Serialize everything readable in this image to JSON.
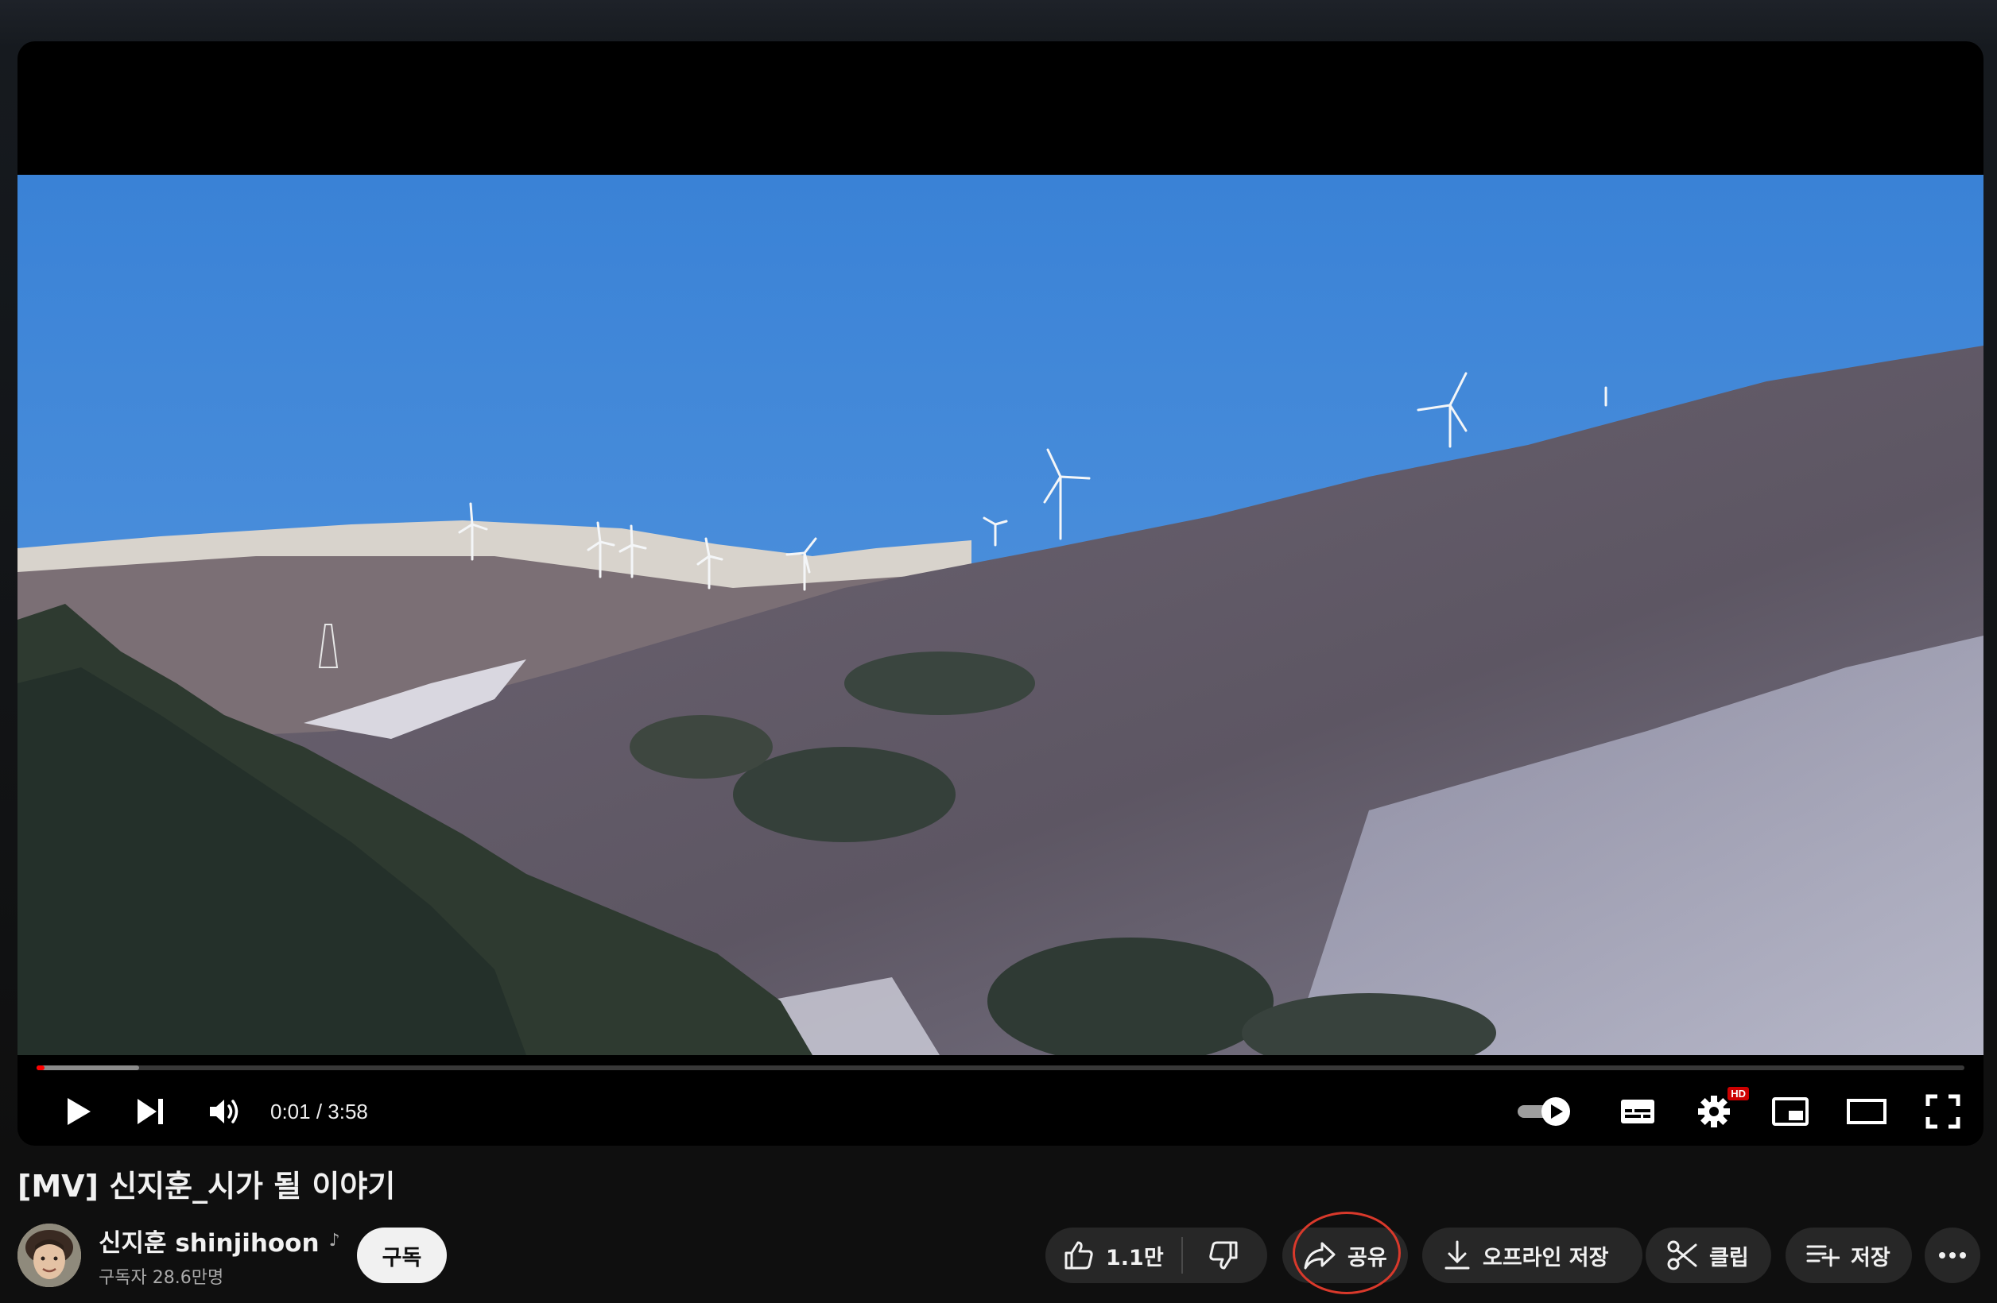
{
  "player": {
    "time_current": "0:01",
    "time_separator": " / ",
    "time_total": "3:58",
    "progress_played_fraction": 0.004,
    "progress_loaded_fraction": 0.053,
    "hd_badge": "HD",
    "autoplay_on": true
  },
  "video": {
    "title": "[MV] 신지훈_시가 될 이야기"
  },
  "channel": {
    "name": "신지훈 shinjihoon",
    "music_note": "♪",
    "subscribers": "구독자 28.6만명"
  },
  "actions": {
    "subscribe_label": "구독",
    "like_count": "1.1만",
    "share_label": "공유",
    "download_label": "오프라인 저장",
    "clip_label": "클립",
    "save_label": "저장"
  },
  "icons": {
    "play": "play-icon",
    "next": "next-icon",
    "volume": "volume-icon",
    "autoplay": "autoplay-toggle-icon",
    "subtitles": "subtitles-icon",
    "settings": "settings-gear-icon",
    "miniplayer": "miniplayer-icon",
    "theater": "theater-mode-icon",
    "fullscreen": "fullscreen-icon",
    "like": "thumbs-up-icon",
    "dislike": "thumbs-down-icon",
    "share": "share-arrow-icon",
    "download": "download-icon",
    "clip": "scissors-icon",
    "save": "playlist-add-icon",
    "more": "more-horizontal-icon"
  },
  "colors": {
    "progress_red": "#ff0000",
    "annotation_ring": "#d9392b",
    "button_bg": "#272727",
    "subscribe_bg": "#f1f1f1"
  }
}
